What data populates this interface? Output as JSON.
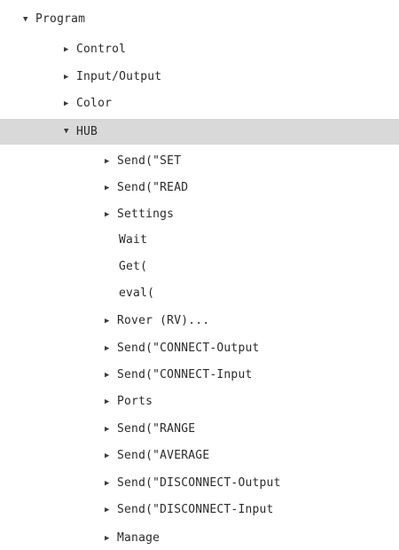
{
  "tree": {
    "root": {
      "label": "Program",
      "expanded": true,
      "arrow_icon": "triangle-down-icon"
    },
    "program_children": [
      {
        "label": "Control",
        "arrow_icon": "triangle-right-icon"
      },
      {
        "label": "Input/Output",
        "arrow_icon": "triangle-right-icon"
      },
      {
        "label": "Color",
        "arrow_icon": "triangle-right-icon"
      },
      {
        "label": "HUB",
        "arrow_icon": "triangle-down-icon",
        "selected": true
      }
    ],
    "hub_children": [
      {
        "label": "Send(\"SET",
        "has_children": true
      },
      {
        "label": "Send(\"READ",
        "has_children": true
      },
      {
        "label": "Settings",
        "has_children": true
      },
      {
        "label": "Wait",
        "has_children": false
      },
      {
        "label": "Get(",
        "has_children": false
      },
      {
        "label": "eval(",
        "has_children": false
      },
      {
        "label": "Rover (RV)...",
        "has_children": true
      },
      {
        "label": "Send(\"CONNECT-Output",
        "has_children": true
      },
      {
        "label": "Send(\"CONNECT-Input",
        "has_children": true
      },
      {
        "label": "Ports",
        "has_children": true
      },
      {
        "label": "Send(\"RANGE",
        "has_children": true
      },
      {
        "label": "Send(\"AVERAGE",
        "has_children": true
      },
      {
        "label": "Send(\"DISCONNECT-Output",
        "has_children": true
      },
      {
        "label": "Send(\"DISCONNECT-Input",
        "has_children": true
      },
      {
        "label": "Manage",
        "has_children": true
      }
    ],
    "colors": {
      "selected_row_bg": "#d9d9d9",
      "text": "#2b2b2b"
    }
  }
}
